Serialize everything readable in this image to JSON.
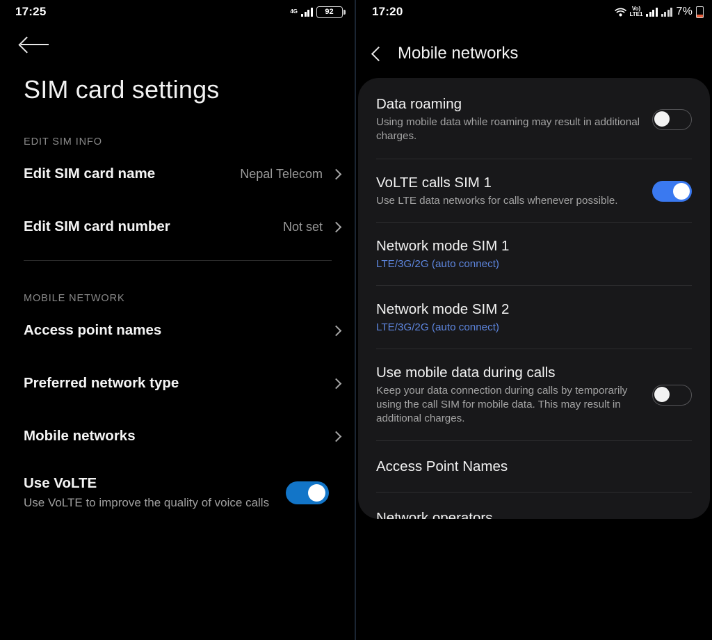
{
  "left": {
    "statusbar": {
      "time": "17:25",
      "network_label": "4G",
      "battery_percent": "92"
    },
    "back_icon": "arrow-left-icon",
    "page_title": "SIM card settings",
    "sections": [
      {
        "label": "EDIT SIM INFO",
        "rows": [
          {
            "title": "Edit SIM card name",
            "value": "Nepal Telecom"
          },
          {
            "title": "Edit SIM card number",
            "value": "Not set"
          }
        ]
      },
      {
        "label": "MOBILE NETWORK",
        "rows": [
          {
            "title": "Access point names",
            "value": ""
          },
          {
            "title": "Preferred network type",
            "value": ""
          },
          {
            "title": "Mobile networks",
            "value": ""
          }
        ]
      }
    ],
    "volte": {
      "title": "Use VoLTE",
      "subtitle": "Use VoLTE to improve the quality of voice calls",
      "state": "on",
      "accent": "#1275c8"
    }
  },
  "right": {
    "statusbar": {
      "time": "17:20",
      "wifi_icon": "wifi-icon",
      "volte_badge_top": "Vo)",
      "volte_badge_bottom": "LTE1",
      "battery_percent": "7%"
    },
    "back_icon": "chevron-left-icon",
    "title": "Mobile networks",
    "items": [
      {
        "title": "Data roaming",
        "subtitle": "Using mobile data while roaming may result in additional charges.",
        "control": "toggle",
        "state": "off"
      },
      {
        "title": "VoLTE calls SIM 1",
        "subtitle": "Use LTE data networks for calls whenever possible.",
        "control": "toggle",
        "state": "on"
      },
      {
        "title": "Network mode SIM 1",
        "subtitle": "LTE/3G/2G (auto connect)",
        "control": "none",
        "subtitle_style": "link"
      },
      {
        "title": "Network mode SIM 2",
        "subtitle": "LTE/3G/2G (auto connect)",
        "control": "none",
        "subtitle_style": "link"
      },
      {
        "title": "Use mobile data during calls",
        "subtitle": "Keep your data connection during calls by temporarily using the call SIM for mobile data. This may result in additional charges.",
        "control": "toggle",
        "state": "off"
      },
      {
        "title": "Access Point Names",
        "subtitle": "",
        "control": "none"
      },
      {
        "title": "Network operators",
        "subtitle": "",
        "control": "none"
      }
    ],
    "accent": "#3a79f0",
    "link_color": "#5d85dd"
  }
}
